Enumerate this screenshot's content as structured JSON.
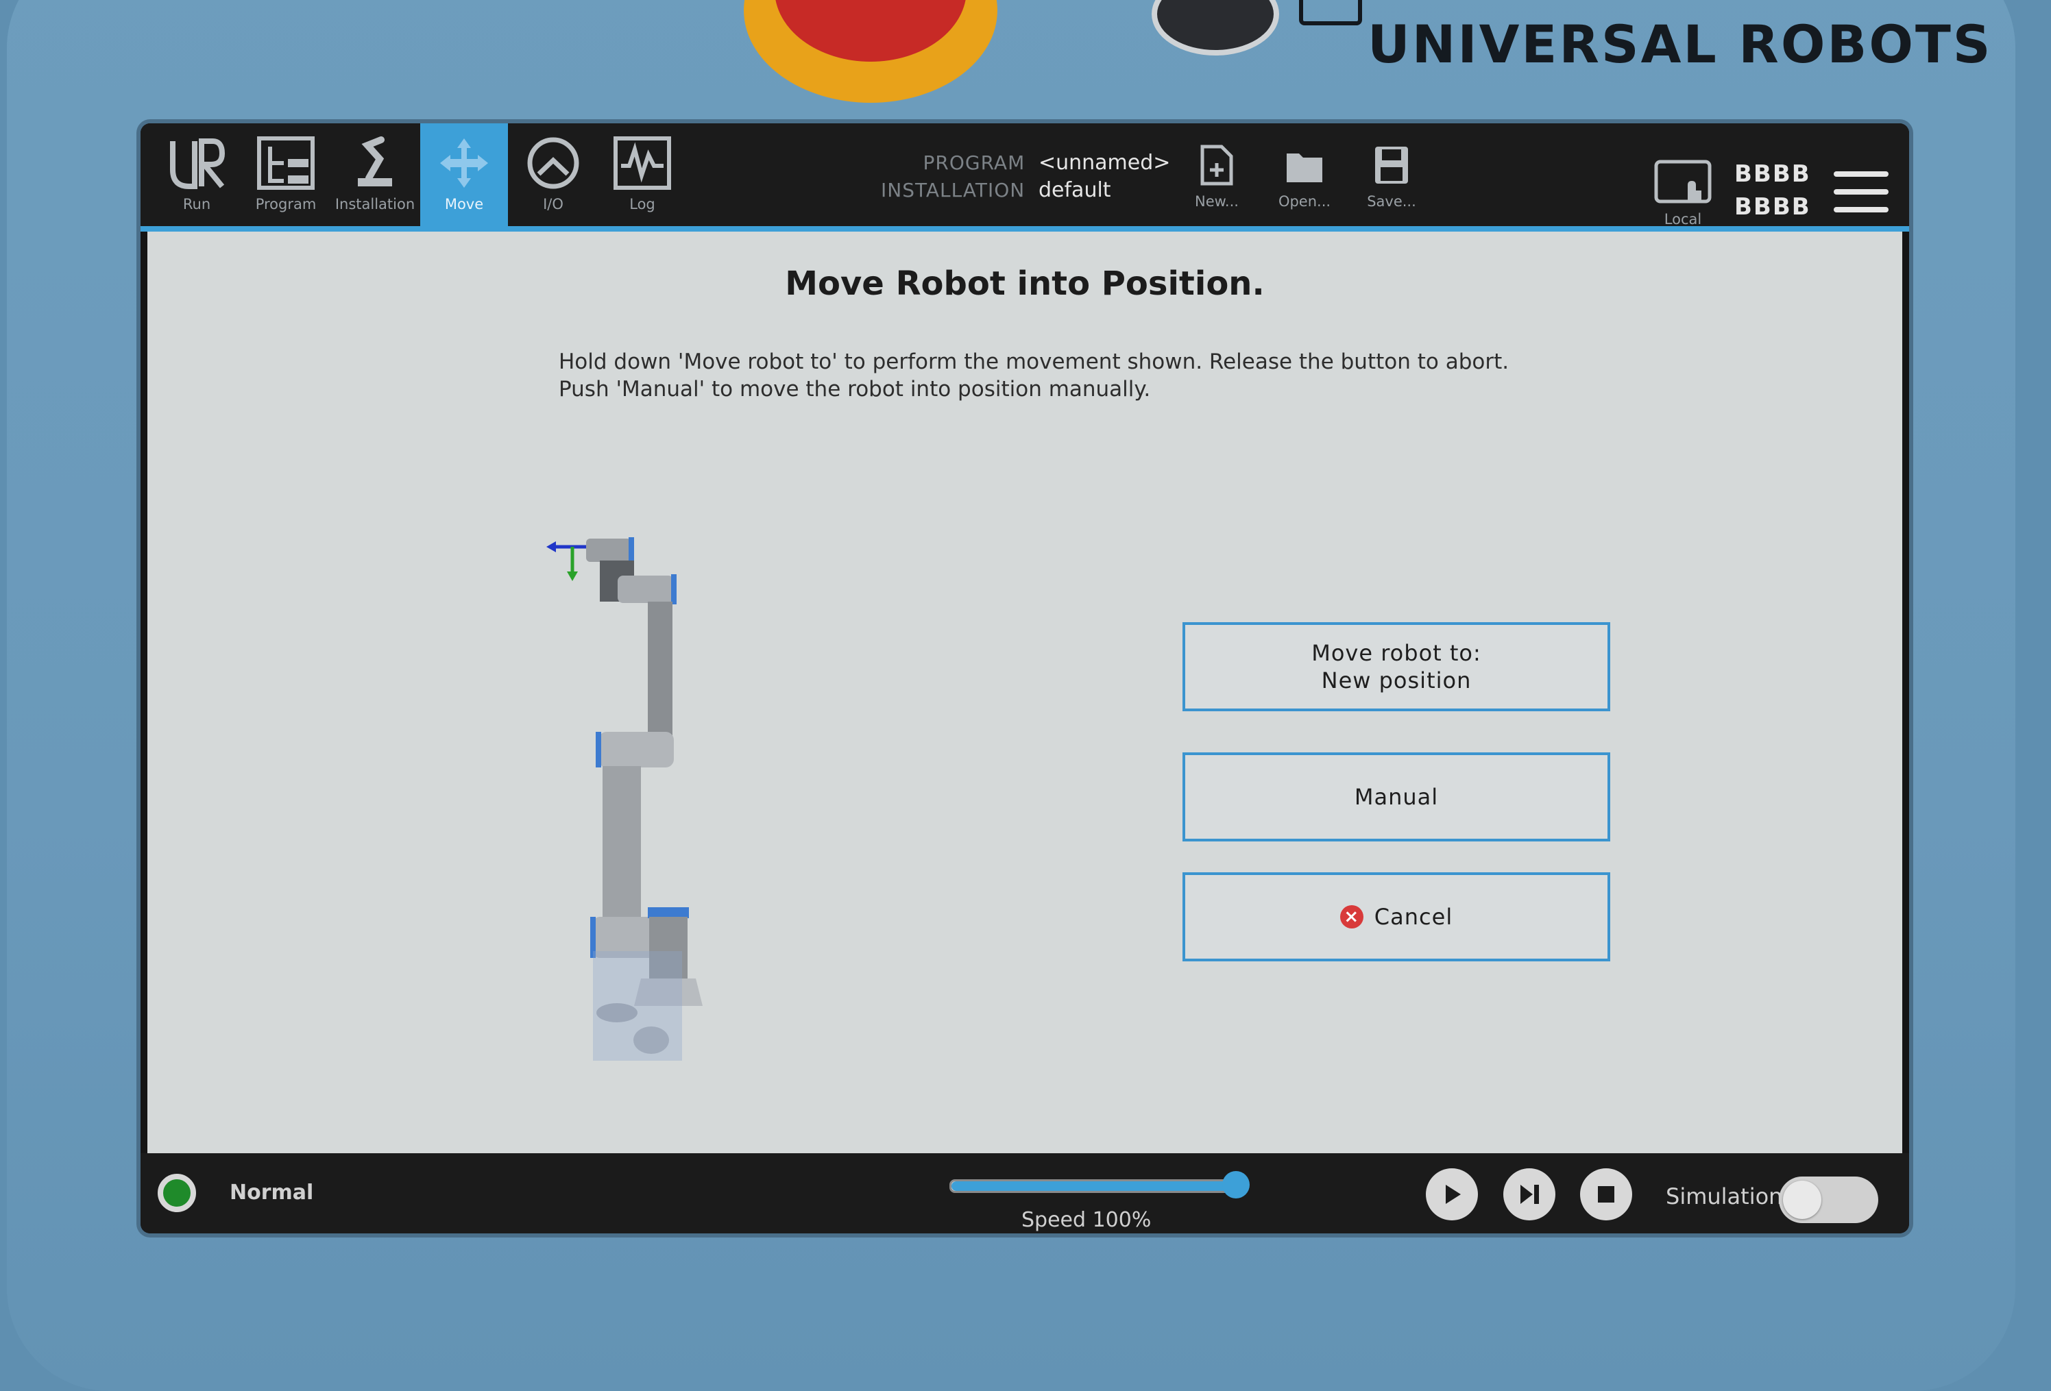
{
  "brand": {
    "name": "UNIVERSAL ROBOTS"
  },
  "nav": {
    "tabs": [
      {
        "label": "Run",
        "icon": "ur-logo-icon",
        "active": false
      },
      {
        "label": "Program",
        "icon": "program-tree-icon",
        "active": false
      },
      {
        "label": "Installation",
        "icon": "robot-arm-icon",
        "active": false
      },
      {
        "label": "Move",
        "icon": "move-arrows-icon",
        "active": true
      },
      {
        "label": "I/O",
        "icon": "io-gauge-icon",
        "active": false
      },
      {
        "label": "Log",
        "icon": "log-waveform-icon",
        "active": false
      }
    ]
  },
  "program_info": {
    "program_label": "PROGRAM",
    "program_value": "<unnamed>",
    "installation_label": "INSTALLATION",
    "installation_value": "default"
  },
  "file_actions": {
    "new_label": "New...",
    "open_label": "Open...",
    "save_label": "Save..."
  },
  "header_right": {
    "local_label": "Local",
    "robot_name_line1": "BBBB",
    "robot_name_line2": "BBBB"
  },
  "main": {
    "title": "Move Robot into Position.",
    "instruction_line1": "Hold down 'Move robot to' to perform the movement shown. Release the button to abort.",
    "instruction_line2": "Push 'Manual' to move the robot into position manually.",
    "move_button_line1": "Move robot to:",
    "move_button_line2": "New position",
    "manual_button": "Manual",
    "cancel_button": "Cancel"
  },
  "footer": {
    "status": "Normal",
    "speed_label": "Speed 100%",
    "speed_fraction": 1.0,
    "simulation_label": "Simulation",
    "simulation_on": false
  },
  "colors": {
    "accent": "#3da0d8",
    "status_ok": "#1f8a2a",
    "cancel_red": "#d83a3a",
    "housing_blue": "#6a99ba"
  }
}
